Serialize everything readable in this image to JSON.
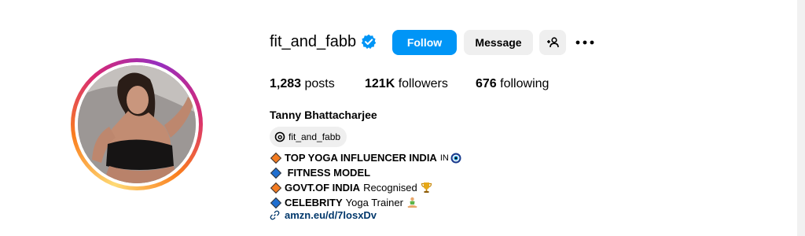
{
  "profile": {
    "username": "fit_and_fabb",
    "full_name": "Tanny Bhattacharjee",
    "threads_handle": "fit_and_fabb",
    "link": "amzn.eu/d/7losxDv"
  },
  "actions": {
    "follow": "Follow",
    "message": "Message"
  },
  "stats": {
    "posts_count": "1,283",
    "posts_label": "posts",
    "followers_count": "121K",
    "followers_label": "followers",
    "following_count": "676",
    "following_label": "following"
  },
  "bio": {
    "line1_bold": "TOP YOGA INFLUENCER INDIA",
    "line1_suffix": "IN",
    "line2_bold": " FITNESS MODEL",
    "line3_bold": "GOVT.OF INDIA",
    "line3_text": "Recognised",
    "line4_bold": "CELEBRITY",
    "line4_text": "Yoga Trainer"
  },
  "colors": {
    "follow_button": "#0095f6",
    "secondary_button": "#efefef",
    "link": "#00376b",
    "verified_badge": "#0095f6"
  },
  "icons": [
    "verified-badge-icon",
    "add-user-icon",
    "more-options-icon",
    "threads-icon",
    "link-icon",
    "evil-eye-icon",
    "trophy-icon",
    "meditation-icon",
    "orange-diamond-icon",
    "blue-diamond-icon"
  ]
}
